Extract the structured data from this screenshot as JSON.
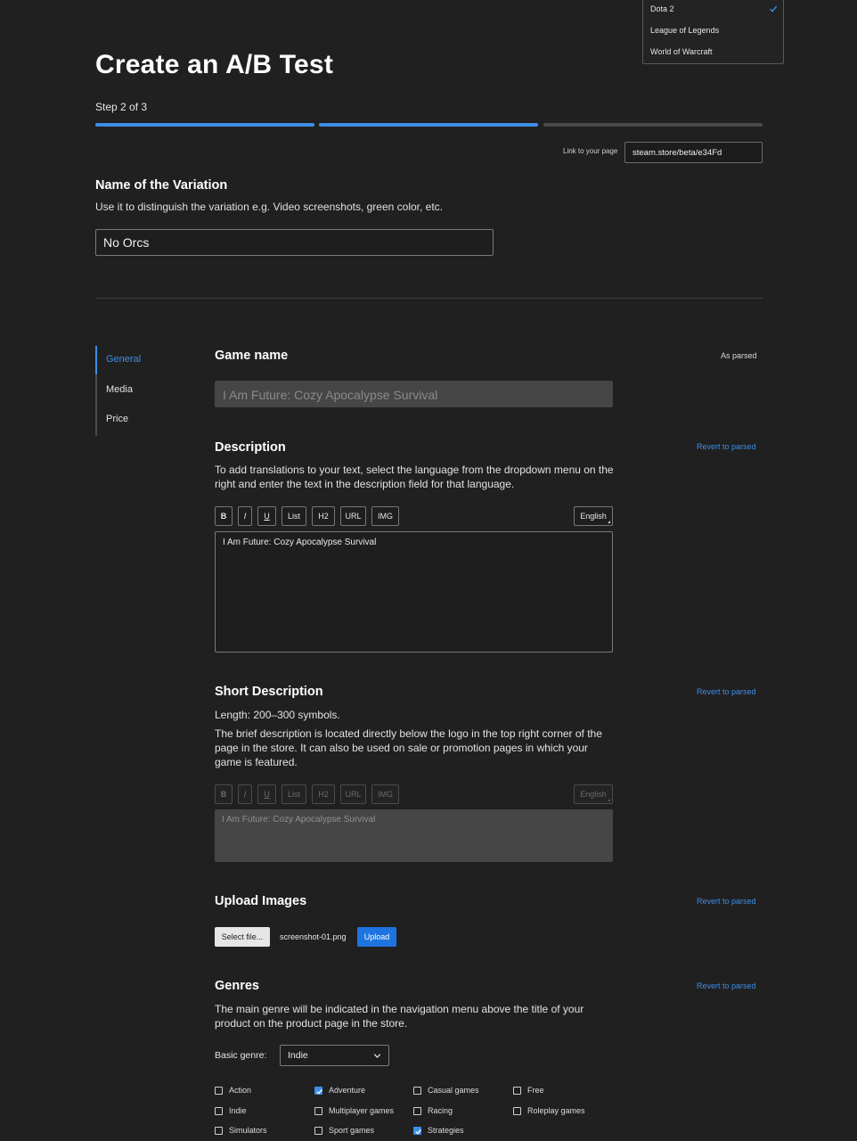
{
  "dropdown": {
    "items": [
      "Dota 2",
      "League of Legends",
      "World of Warcraft"
    ],
    "selected_index": 0
  },
  "title": "Create an A/B Test",
  "step_text": "Step 2 of 3",
  "steps": {
    "total": 3,
    "completed": 2
  },
  "link": {
    "label": "Link to your page",
    "value": "steam.store/beta/e34Fd"
  },
  "variation": {
    "heading": "Name of the Variation",
    "hint": "Use it to distinguish the variation e.g. Video screenshots, green color, etc.",
    "value": "No Orcs"
  },
  "sidebar": {
    "items": [
      {
        "label": "General",
        "active": true
      },
      {
        "label": "Media",
        "active": false
      },
      {
        "label": "Price",
        "active": false
      }
    ]
  },
  "game_name": {
    "heading": "Game name",
    "note": "As parsed",
    "value": "I Am Future: Cozy Apocalypse Survival"
  },
  "description": {
    "heading": "Description",
    "revert": "Revert to parsed",
    "text": "To add translations to your text, select the language from the dropdown menu on the right and enter the text in the description field for that language.",
    "toolbar": [
      "B",
      "I",
      "U",
      "List",
      "H2",
      "URL",
      "IMG"
    ],
    "language": "English",
    "content": "I Am Future: Cozy Apocalypse Survival"
  },
  "short_description": {
    "heading": "Short Description",
    "revert": "Revert to parsed",
    "length": "Length: 200–300 symbols.",
    "text": "The brief description is located directly below the logo in the top right corner of the page in the store. It can also be used on sale or promotion pages in which your game is featured.",
    "toolbar": [
      "B",
      "I",
      "U",
      "List",
      "H2",
      "URL",
      "IMG"
    ],
    "language": "English",
    "content": "I Am Future: Cozy Apocalypse Survival"
  },
  "upload": {
    "heading": "Upload Images",
    "revert": "Revert to parsed",
    "select_label": "Select file...",
    "file_name": "screenshot-01.png",
    "upload_label": "Upload"
  },
  "genres": {
    "heading": "Genres",
    "revert": "Revert to parsed",
    "text": "The main genre will be indicated in the navigation menu above the title of your product on the product page in the store.",
    "basic_label": "Basic genre:",
    "basic_value": "Indie",
    "checkboxes": [
      {
        "label": "Action",
        "checked": false
      },
      {
        "label": "Adventure",
        "checked": true
      },
      {
        "label": "Casual games",
        "checked": false
      },
      {
        "label": "Free",
        "checked": false
      },
      {
        "label": "Indie",
        "checked": false
      },
      {
        "label": "Multiplayer games",
        "checked": false
      },
      {
        "label": "Racing",
        "checked": false
      },
      {
        "label": "Roleplay games",
        "checked": false
      },
      {
        "label": "Simulators",
        "checked": false
      },
      {
        "label": "Sport games",
        "checked": false
      },
      {
        "label": "Strategies",
        "checked": true
      }
    ]
  },
  "colors": {
    "accent": "#3d8ee6",
    "upload_button": "#1d74e0",
    "background": "#202020"
  }
}
